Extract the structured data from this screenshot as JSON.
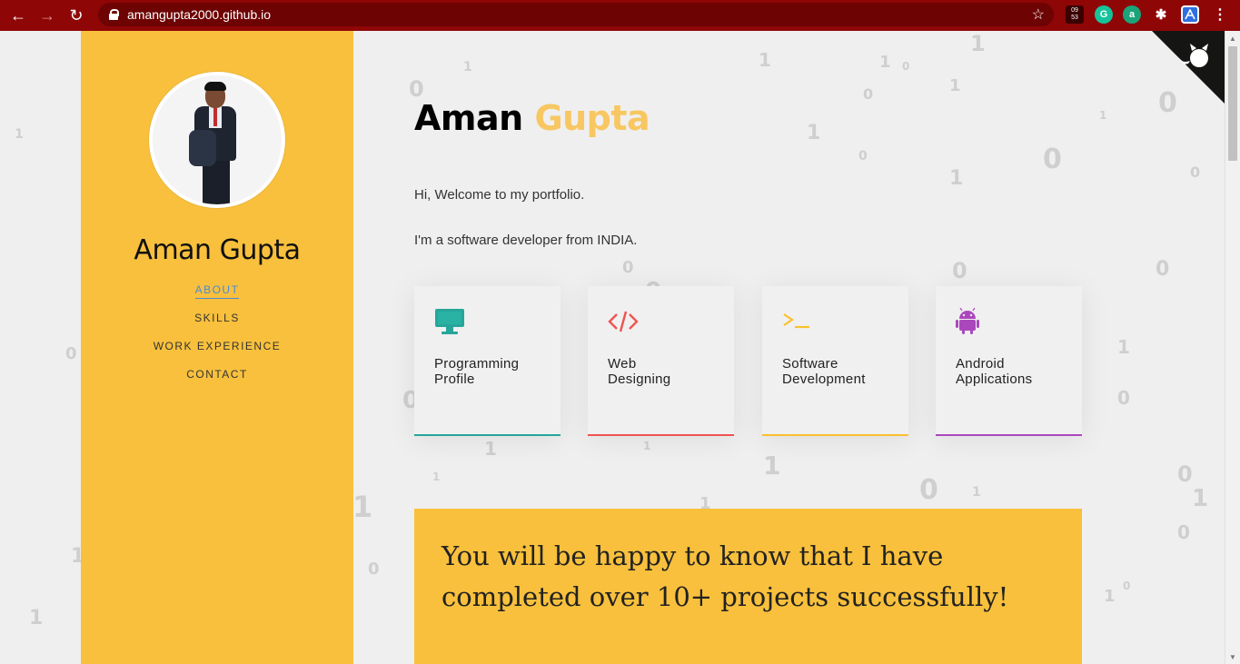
{
  "browser": {
    "url": "amangupta2000.github.io",
    "extensions": {
      "time_top": "09",
      "time_bottom": "53",
      "grammarly": "G",
      "a_ext": "a",
      "puzzle": "✱",
      "menu": "⋮"
    }
  },
  "sidebar": {
    "name": "Aman Gupta",
    "menu": [
      "ABOUT",
      "SKILLS",
      "WORK EXPERIENCE",
      "CONTACT"
    ]
  },
  "main": {
    "title_first": "Aman",
    "title_last": "Gupta",
    "intro": [
      "Hi, Welcome to my portfolio.",
      "I'm a software developer from INDIA."
    ],
    "cards": [
      {
        "line1": "Programming",
        "line2": "Profile",
        "icon": "monitor-icon",
        "color": "#26a69a"
      },
      {
        "line1": "Web",
        "line2": "Designing",
        "icon": "code-icon",
        "color": "#ef5350"
      },
      {
        "line1": "Software",
        "line2": "Development",
        "icon": "terminal-icon",
        "color": "#fbc02d"
      },
      {
        "line1": "Android",
        "line2": "Applications",
        "icon": "android-icon",
        "color": "#ab47bc"
      }
    ],
    "banner_text": "You will be happy to know that I have completed over 10+ projects successfully!"
  },
  "colors": {
    "chrome": "#8f0606",
    "sidebar": "#f8c03c",
    "accent_name": "#f8c762",
    "active_link": "#4a8bd6"
  }
}
